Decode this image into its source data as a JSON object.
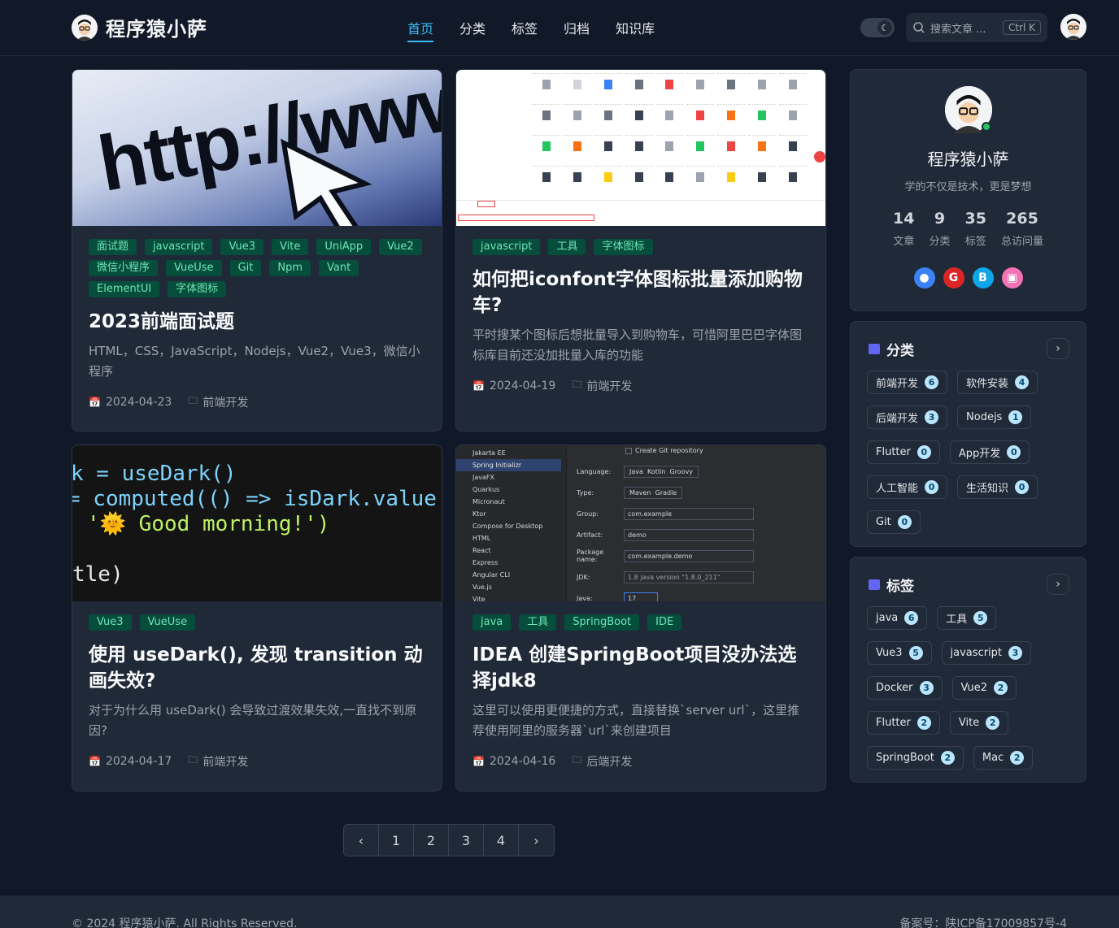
{
  "header": {
    "site_title": "程序猿小萨",
    "nav": [
      {
        "label": "首页",
        "active": true
      },
      {
        "label": "分类"
      },
      {
        "label": "标签"
      },
      {
        "label": "归档"
      },
      {
        "label": "知识库"
      }
    ],
    "theme_icon": "moon-icon",
    "search_placeholder": "搜索文章 ...",
    "search_shortcut": "Ctrl K"
  },
  "posts": [
    {
      "tags": [
        "面试题",
        "javascript",
        "Vue3",
        "Vite",
        "UniApp",
        "Vue2",
        "微信小程序",
        "VueUse",
        "Git",
        "Npm",
        "Vant",
        "ElementUI",
        "字体图标"
      ],
      "title": "2023前端面试题",
      "desc": "HTML，CSS，JavaScript，Nodejs，Vue2，Vue3，微信小程序",
      "date": "2024-04-23",
      "category": "前端开发",
      "image_text": "http://www."
    },
    {
      "tags": [
        "javascript",
        "工具",
        "字体图标"
      ],
      "title": "如何把iconfont字体图标批量添加购物车?",
      "desc": "平时搜某个图标后想批量导入到购物车，可惜阿里巴巴字体图标库目前还没加批量入库的功能",
      "date": "2024-04-19",
      "category": "前端开发"
    },
    {
      "tags": [
        "Vue3",
        "VueUse"
      ],
      "title": "使用 useDark(), 发现 transition 动画失效?",
      "desc": "对于为什么用 useDark() 会导致过渡效果失效,一直找不到原因?",
      "date": "2024-04-17",
      "category": "前端开发",
      "code_lines": [
        "k = useDark()",
        "= computed(() => isDark.value ?",
        "'🌞 Good morning!')",
        "tle)"
      ]
    },
    {
      "tags": [
        "java",
        "工具",
        "SpringBoot",
        "IDE"
      ],
      "title": "IDEA 创建SpringBoot项目没办法选择jdk8",
      "desc": "这里可以使用更便捷的方式，直接替换`server url`，这里推荐使用阿里的服务器`url`来创建项目",
      "date": "2024-04-16",
      "category": "后端开发",
      "ide": {
        "sidebar": [
          "Jakarta EE",
          "Spring Initializr",
          "JavaFX",
          "Quarkus",
          "Micronaut",
          "Ktor",
          "Compose for Desktop",
          "HTML",
          "React",
          "Express",
          "Angular CLI",
          "Vue.js",
          "Vite"
        ],
        "fields": [
          {
            "label": "Language:",
            "value": "Java  Kotlin  Groovy"
          },
          {
            "label": "Type:",
            "value": "Maven  Gradle"
          },
          {
            "label": "Group:",
            "value": "com.example"
          },
          {
            "label": "Artifact:",
            "value": "demo"
          },
          {
            "label": "Package name:",
            "value": "com.example.demo"
          },
          {
            "label": "JDK:",
            "value": "1.8 java version \"1.8.0_211\""
          },
          {
            "label": "Java:",
            "value": "17"
          }
        ],
        "checkbox": "Create Git repository"
      }
    }
  ],
  "profile": {
    "name": "程序猿小萨",
    "motto": "学的不仅是技术，更是梦想",
    "stats": [
      {
        "value": "14",
        "label": "文章"
      },
      {
        "value": "9",
        "label": "分类"
      },
      {
        "value": "35",
        "label": "标签"
      },
      {
        "value": "265",
        "label": "总访问量"
      }
    ],
    "socials": [
      {
        "icon": "github-icon",
        "color": "#3b82f6",
        "glyph": "●"
      },
      {
        "icon": "gitee-icon",
        "color": "#dc2626",
        "glyph": "G"
      },
      {
        "icon": "blog-icon",
        "color": "#0ea5e9",
        "glyph": "B"
      },
      {
        "icon": "bilibili-icon",
        "color": "#f472b6",
        "glyph": "▣"
      }
    ]
  },
  "categories": {
    "title": "分类",
    "items": [
      {
        "name": "前端开发",
        "count": "6"
      },
      {
        "name": "软件安装",
        "count": "4"
      },
      {
        "name": "后端开发",
        "count": "3"
      },
      {
        "name": "Nodejs",
        "count": "1"
      },
      {
        "name": "Flutter",
        "count": "0"
      },
      {
        "name": "App开发",
        "count": "0"
      },
      {
        "name": "人工智能",
        "count": "0"
      },
      {
        "name": "生活知识",
        "count": "0"
      },
      {
        "name": "Git",
        "count": "0"
      }
    ]
  },
  "tags_panel": {
    "title": "标签",
    "items": [
      {
        "name": "java",
        "count": "6"
      },
      {
        "name": "工具",
        "count": "5"
      },
      {
        "name": "Vue3",
        "count": "5"
      },
      {
        "name": "javascript",
        "count": "3"
      },
      {
        "name": "Docker",
        "count": "3"
      },
      {
        "name": "Vue2",
        "count": "2"
      },
      {
        "name": "Flutter",
        "count": "2"
      },
      {
        "name": "Vite",
        "count": "2"
      },
      {
        "name": "SpringBoot",
        "count": "2"
      },
      {
        "name": "Mac",
        "count": "2"
      }
    ]
  },
  "pagination": {
    "prev": "‹",
    "pages": [
      "1",
      "2",
      "3",
      "4"
    ],
    "next": "›"
  },
  "footer": {
    "copyright": "© 2024 程序猿小萨. All Rights Reserved.",
    "icp": "备案号：陕ICP备17009857号-4"
  }
}
